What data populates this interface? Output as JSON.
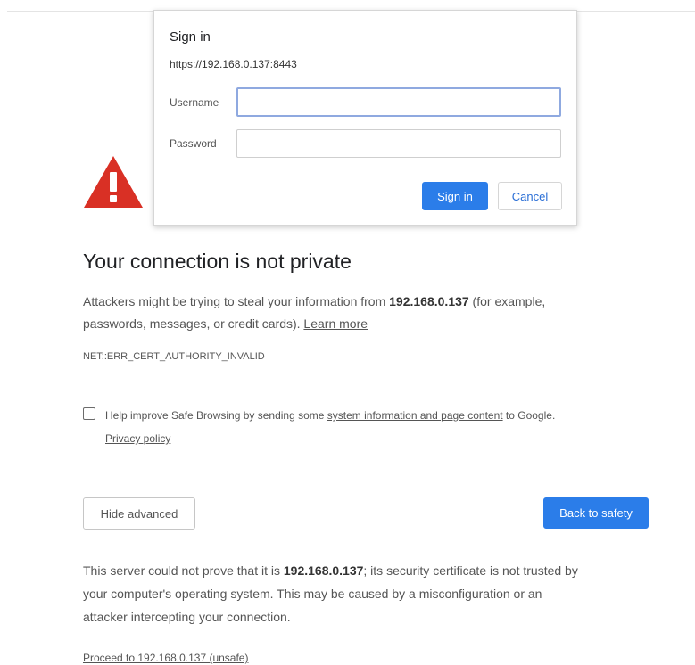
{
  "dialog": {
    "title": "Sign in",
    "url": "https://192.168.0.137:8443",
    "username_label": "Username",
    "username_value": "",
    "password_label": "Password",
    "password_value": "",
    "signin_label": "Sign in",
    "cancel_label": "Cancel"
  },
  "page": {
    "heading": "Your connection is not private",
    "intro_1": "Attackers might be trying to steal your information from ",
    "host": "192.168.0.137",
    "intro_2": " (for example,",
    "intro_3": "passwords, messages, or credit cards). ",
    "learn_more": "Learn more",
    "error_code": "NET::ERR_CERT_AUTHORITY_INVALID",
    "safe_browsing_1": "Help improve Safe Browsing by sending some ",
    "safe_browsing_link": "system information and page content",
    "safe_browsing_2": " to Google.",
    "privacy_policy": "Privacy policy",
    "checkbox_checked": false,
    "hide_advanced_label": "Hide advanced",
    "back_to_safety_label": "Back to safety",
    "details_1": "This server could not prove that it is ",
    "details_host": "192.168.0.137",
    "details_2": "; its security certificate is not trusted by",
    "details_3": "your computer's operating system. This may be caused by a misconfiguration or an",
    "details_4": "attacker intercepting your connection.",
    "proceed_link": "Proceed to 192.168.0.137 (unsafe)"
  },
  "icons": {
    "warning": "warning-triangle-icon"
  },
  "colors": {
    "accent": "#2b7de9",
    "warning": "#d93025",
    "text": "#555555"
  }
}
